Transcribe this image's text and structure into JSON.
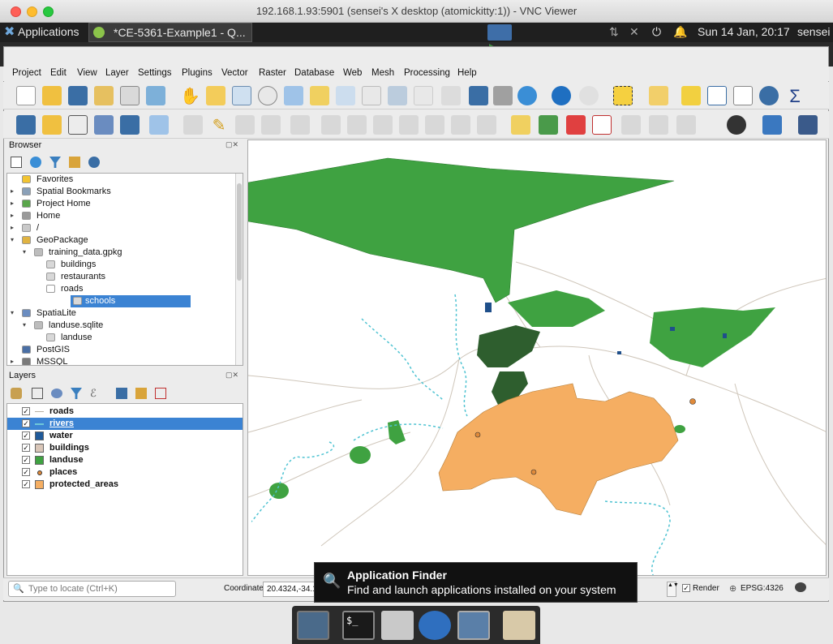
{
  "vnc": {
    "title": "192.168.1.93:5901 (sensei's X desktop (atomickitty:1)) - VNC Viewer"
  },
  "panel": {
    "applications": "Applications",
    "task_title": "*CE-5361-Example1 - Q...",
    "clock": "Sun 14 Jan, 20:17",
    "user": "sensei"
  },
  "menu": [
    "Project",
    "Edit",
    "View",
    "Layer",
    "Settings",
    "Plugins",
    "Vector",
    "Raster",
    "Database",
    "Web",
    "Mesh",
    "Processing",
    "Help"
  ],
  "browser": {
    "title": "Browser",
    "items": [
      {
        "label": "Favorites",
        "indent": 0,
        "arrow": "",
        "icon": "star-icon",
        "color": "#f2c431"
      },
      {
        "label": "Spatial Bookmarks",
        "indent": 0,
        "arrow": "▸",
        "icon": "bookmark-icon",
        "color": "#8aa0b8"
      },
      {
        "label": "Project Home",
        "indent": 0,
        "arrow": "▸",
        "icon": "project-home-icon",
        "color": "#5aa64b"
      },
      {
        "label": "Home",
        "indent": 0,
        "arrow": "▸",
        "icon": "home-icon",
        "color": "#9a9a9a"
      },
      {
        "label": "/",
        "indent": 0,
        "arrow": "▸",
        "icon": "folder-icon",
        "color": "#c9c9c9"
      },
      {
        "label": "GeoPackage",
        "indent": 0,
        "arrow": "▾",
        "icon": "geopackage-icon",
        "color": "#e0b341"
      },
      {
        "label": "training_data.gpkg",
        "indent": 1,
        "arrow": "▾",
        "icon": "database-icon",
        "color": "#bdbdbd"
      },
      {
        "label": "buildings",
        "indent": 2,
        "arrow": "",
        "icon": "polygon-layer-icon",
        "color": "#d8d8d8"
      },
      {
        "label": "restaurants",
        "indent": 2,
        "arrow": "",
        "icon": "polygon-layer-icon",
        "color": "#d8d8d8"
      },
      {
        "label": "roads",
        "indent": 2,
        "arrow": "",
        "icon": "line-layer-icon",
        "color": "#ffffff"
      },
      {
        "label": "schools",
        "indent": 2,
        "arrow": "",
        "icon": "polygon-layer-icon",
        "color": "#d8d8d8",
        "selected": true
      },
      {
        "label": "SpatiaLite",
        "indent": 0,
        "arrow": "▾",
        "icon": "spatialite-icon",
        "color": "#6a8cc0"
      },
      {
        "label": "landuse.sqlite",
        "indent": 1,
        "arrow": "▾",
        "icon": "database-icon",
        "color": "#bdbdbd"
      },
      {
        "label": "landuse",
        "indent": 2,
        "arrow": "",
        "icon": "polygon-layer-icon",
        "color": "#d8d8d8"
      },
      {
        "label": "PostGIS",
        "indent": 0,
        "arrow": "",
        "icon": "postgis-icon",
        "color": "#4a6fa5"
      },
      {
        "label": "MSSQL",
        "indent": 0,
        "arrow": "▸",
        "icon": "mssql-icon",
        "color": "#7a7a7a"
      }
    ]
  },
  "layers": {
    "title": "Layers",
    "items": [
      {
        "name": "roads",
        "symbol": "line",
        "color": "#b8b0a4",
        "checked": "✓"
      },
      {
        "name": "rivers",
        "symbol": "dashline",
        "color": "#6fc7d8",
        "checked": "✓",
        "selected": true
      },
      {
        "name": "water",
        "symbol": "fill",
        "color": "#1f5a9a",
        "checked": "✓"
      },
      {
        "name": "buildings",
        "symbol": "fill",
        "color": "#d9c6b8",
        "checked": "✓"
      },
      {
        "name": "landuse",
        "symbol": "fill",
        "color": "#3fa241",
        "checked": "✓"
      },
      {
        "name": "places",
        "symbol": "point",
        "color": "#e08a3a",
        "checked": "✓"
      },
      {
        "name": "protected_areas",
        "symbol": "fill",
        "color": "#f5ae62",
        "checked": "✓"
      }
    ]
  },
  "status": {
    "locate_placeholder": "Type to locate (Ctrl+K)",
    "coordinate_label": "Coordinate",
    "coordinate_value": "20.4324,-34.1",
    "render_label": "Render",
    "crs": "EPSG:4326"
  },
  "appfinder": {
    "title": "Application Finder",
    "subtitle": "Find and launch applications installed on your system"
  },
  "colors": {
    "landuse": "#3fa241",
    "protected": "#f5ae62",
    "rivers": "#4fc3d2",
    "roads": "#c9c0b4",
    "water": "#1f4f8a"
  }
}
